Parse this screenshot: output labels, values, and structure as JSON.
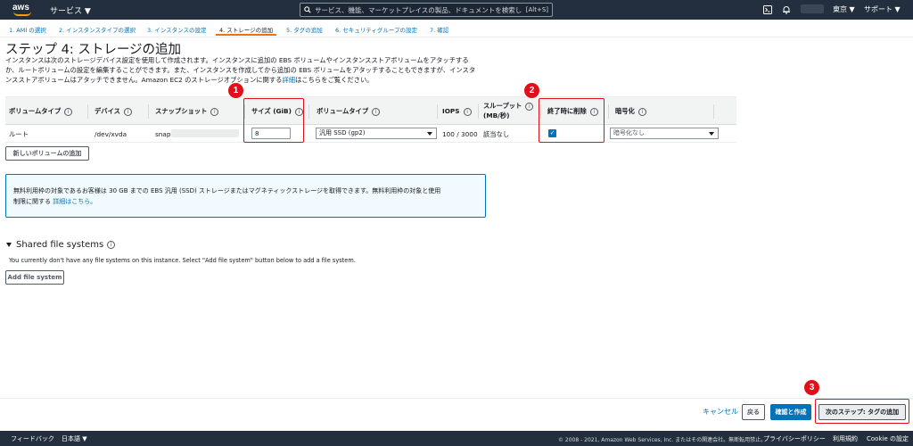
{
  "topnav": {
    "logo": "aws",
    "services": "サービス ▼",
    "search_placeholder": "サービス、機能、マーケットプレイスの製品、ドキュメントを検索し",
    "search_shortcut": "[Alt+S]",
    "region": "東京 ▼",
    "support": "サポート ▼"
  },
  "tabs": [
    {
      "label": "1. AMI の選択"
    },
    {
      "label": "2. インスタンスタイプの選択"
    },
    {
      "label": "3. インスタンスの設定"
    },
    {
      "label": "4. ストレージの追加"
    },
    {
      "label": "5. タグの追加"
    },
    {
      "label": "6. セキュリティグループの設定"
    },
    {
      "label": "7. 確認"
    }
  ],
  "heading": "ステップ 4: ストレージの追加",
  "description": {
    "line1": "インスタンスは次のストレージデバイス設定を使用して作成されます。インスタンスに追加の EBS ボリュームやインスタンスストアボリュームをアタッチする",
    "line2": "か、ルートボリュームの設定を編集することができます。また、インスタンスを作成してから追加の EBS ボリュームをアタッチすることもできますが、インスタ",
    "line3_pre": "ンスストアボリュームはアタッチできません。Amazon EC2 のストレージオプションに関する",
    "line3_link": "詳細",
    "line3_post": "はこちらをご覧ください。"
  },
  "table": {
    "headers": {
      "volume_type": "ボリュームタイプ",
      "device": "デバイス",
      "snapshot": "スナップショット",
      "size": "サイズ (GiB)",
      "volume_kind": "ボリュームタイプ",
      "iops": "IOPS",
      "throughput_1": "スループット",
      "throughput_2": "(MB/秒)",
      "delete_on_termination": "終了時に削除",
      "encryption": "暗号化"
    },
    "row": {
      "volume_type": "ルート",
      "device": "/dev/xvda",
      "snapshot": "snap",
      "size": "8",
      "volume_kind": "汎用 SSD (gp2)",
      "iops": "100 / 3000",
      "throughput": "該当なし",
      "encryption": "暗号化なし"
    },
    "info_glyph": "i",
    "check_glyph": "✓"
  },
  "add_volume_button": "新しいボリュームの追加",
  "infobox": {
    "line1": "無料利用枠の対象であるお客様は 30 GB までの EBS 汎用 (SSD) ストレージまたはマグネティックストレージを取得できます。無料利用枠の対象と使用",
    "line2_pre": "制限に関する",
    "line2_link": "詳細はこちら。"
  },
  "shared_fs": {
    "title": "Shared file systems",
    "description": "You currently don't have any file systems on this instance. Select \"Add file system\" button below to add a file system.",
    "button": "Add file system"
  },
  "actions": {
    "cancel": "キャンセル",
    "back": "戻る",
    "review": "確認と作成",
    "next": "次のステップ: タグの追加"
  },
  "annotations": {
    "one": "1",
    "two": "2",
    "three": "3"
  },
  "footer": {
    "feedback": "フィードバック",
    "language": "日本語 ▼",
    "copyright": "© 2008 - 2021, Amazon Web Services, Inc. またはその関連会社。無断転用禁止。",
    "privacy": "プライバシーポリシー",
    "terms": "利用規約",
    "cookie": "Cookie の設定"
  },
  "colors": {
    "nav": "#232f3e",
    "link": "#0073bb",
    "accent": "#ec7211",
    "annotation": "#e0101a"
  }
}
